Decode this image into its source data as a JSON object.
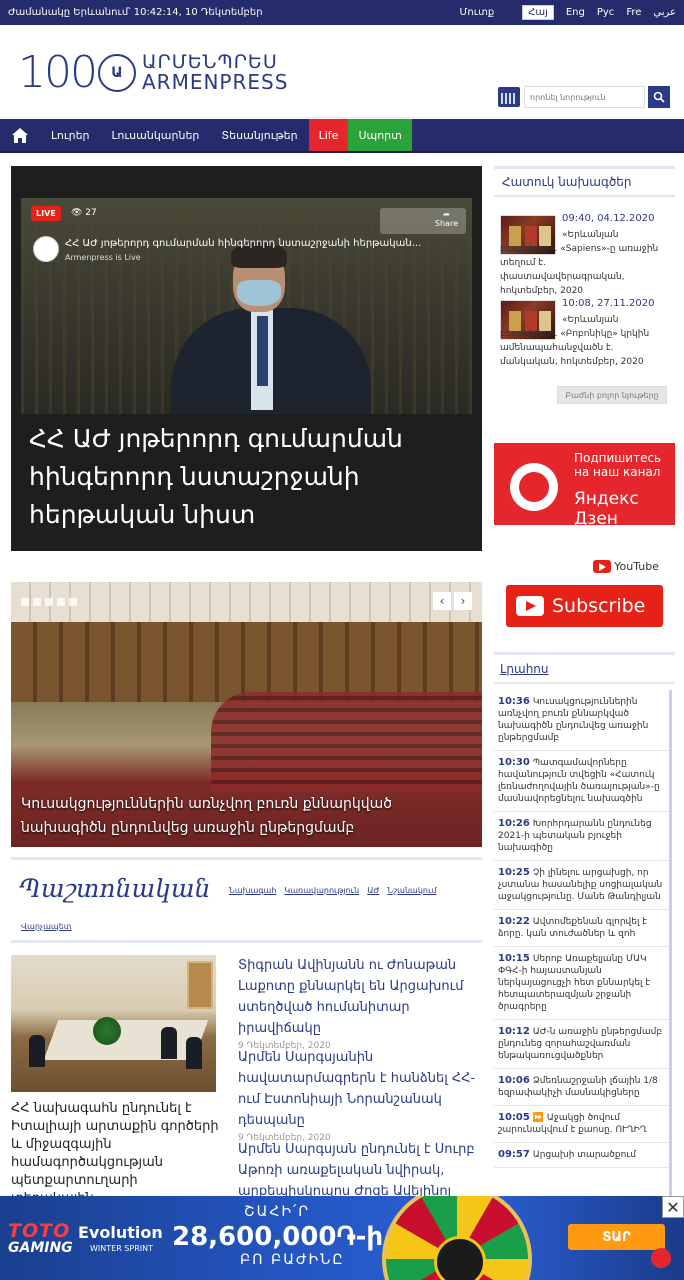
{
  "topbar": {
    "time_text": "Ժամանակը Երևանում՝ 10:42:14,   10 Դեկտեմբեր",
    "login": "Մուտք",
    "languages": [
      "Հայ",
      "Eng",
      "Рус",
      "Fre",
      "عربي"
    ],
    "active_language": "Հայ"
  },
  "header": {
    "logo_number": "100",
    "logo_circle": "Ա",
    "logo_hy": "ԱՐՄԵՆՊՐԵՍ",
    "logo_en": "ARMENPRESS",
    "search_placeholder": "որոնել նորություն"
  },
  "nav": {
    "items": [
      "Լուրեր",
      "Լուսանկարներ",
      "Տեսանյութեր",
      "Life",
      "Սպորտ"
    ]
  },
  "live": {
    "badge": "LIVE",
    "views": "27",
    "video_title": "ՀՀ ԱԺ յոթերորդ գումարման հինգերորդ նստաշրջանի հերթական...",
    "channel": "Armenpress is Live",
    "share": "Share",
    "title": "ՀՀ ԱԺ յոթերորդ գումարման հինգերորդ նստաշրջանի հերթական նիստ"
  },
  "slider": {
    "caption": "Կուսակցություններին առնչվող բուռն քննարկված նախագիծն ընդունվեց առաջին ընթերցմամբ"
  },
  "official": {
    "title": "Պաշտոնական",
    "links": [
      "Նախագահ",
      "Կառավարություն",
      "ԱԺ",
      "Նշանակում"
    ],
    "last_link": "Վարչապետ",
    "featured_title": "ՀՀ նախագահն ընդունել է Իտալիայի արտաքին գործերի և միջազգային համագործակցության պետքարտուղարի տեղակալին",
    "news": [
      {
        "title": "Տիգրան Ավինյանն ու Ժոնաթան Լաքոտը քննարկել են Արցախում ստեղծված հումանիտար իրավիճակը",
        "date": "9 Դեկտեմբեր, 2020"
      },
      {
        "title": "Արմեն Սարգսյանին հավատարմագրերն է հանձնել ՀՀ-ում Էստոնիայի Նորանշանակ դեսպանը",
        "date": "9 Դեկտեմբեր, 2020"
      },
      {
        "title": "Արմեն Սարգսյան ընդունել է Սուրբ Աթոռի առաքելական նվիրակ, արքեպիսկոպոս Ժոզե Ավելինոյ",
        "date": ""
      }
    ]
  },
  "sidebar": {
    "special_title": "Հատուկ նախագծեր",
    "projects": [
      {
        "date": "09:40, 04.12.2020",
        "text": "«Երևանյան բեսթսելեր». «Sapiens»-ը առաջին տեղում է. փաստավավերագրական, հոկտեմբեր, 2020"
      },
      {
        "date": "10:08, 27.11.2020",
        "text": "«Երևանյան բեսթսելեր». «Բոբոնիկը» կրկին ամենապահանջվածն է. մանկական, հոկտեմբեր, 2020"
      }
    ],
    "all_button": "Բաժնի բոլոր նյութերը",
    "dzen_line1": "Подпишитесь на наш канал",
    "dzen_line2": "Яндекс Дзен",
    "youtube_logo": "YouTube",
    "subscribe": "Subscribe",
    "feed_title": "Լրահոս",
    "feed": [
      {
        "time": "10:36",
        "text": "Կուսակցություններին առնչվող բուռն քննարկված նախագիծն ընդունվեց առաջին ընթերցմամբ"
      },
      {
        "time": "10:30",
        "text": "Պատգամավորները հավանություն տվեցին «Հատուկ լեռնաժողովային ծառայության»-ը մասնավորեցնելու նախագծին"
      },
      {
        "time": "10:26",
        "text": "Խորհրդարանն ընդունեց 2021-ի պետական բյուջեի նախագիծը"
      },
      {
        "time": "10:25",
        "text": "Չի լինելու արցախցի, որ չստանա հասանելիք սոցիալական աջակցությունը. Մանե Թանդիլյան"
      },
      {
        "time": "10:22",
        "text": "Ավտոմեքենան գլորվել է ձորը. կան տուժածներ և զոհ"
      },
      {
        "time": "10:15",
        "text": "Սերոբ Առաքելյանը ՄԱԿ ՓԳՀ-ի հայաստանյան ներկայացուցչի հետ քննարկել է հետպատերազմյան շրջանի ծրագրերը"
      },
      {
        "time": "10:12",
        "text": "ԱԺ-ն առաջին ընթերցմամբ ընդունեց զորահաշվառման ենթակառուցվածքներ"
      },
      {
        "time": "10:06",
        "text": "Ձմեռնաշրջանի լճային 1/8 եզրափակիչի մասնակիցները"
      },
      {
        "time": "10:05",
        "text": "⏩ Աջակցի ծովում շարունակվում է քաոսը. ՈՒՂԻՂ"
      },
      {
        "time": "09:57",
        "text": "Արցախի տարածքում"
      }
    ]
  },
  "ad": {
    "brand1": "TOTO",
    "brand1b": "GAMING",
    "brand2": "Evolution",
    "brand2b": "WINTER SPRINT",
    "line1": "ՇԱՀԻ՛Ր",
    "line2": "28,600,000֏-ի",
    "line3": "ԲՈ ԲԱԺԻՆԸ",
    "cta": "ՏԱՐ",
    "close": "✕"
  }
}
